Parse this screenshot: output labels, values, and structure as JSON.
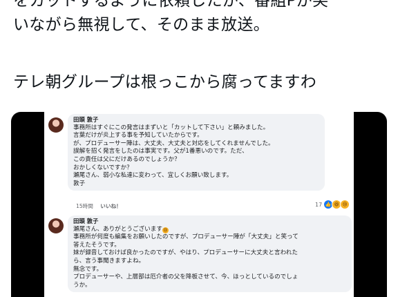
{
  "tweet": {
    "line1": "をカットするように依頼したが、番組Pが笑",
    "line2": "いながら無視して、そのまま放送。",
    "line3": "テレ朝グループは根っこから腐ってますわ"
  },
  "comments": [
    {
      "author": "田頭 敦子",
      "lines": [
        "事務所はすぐにこの発言はまずいと「カットして下さい」と頼みました。",
        "言葉だけが炎上する事を予知していたからです。",
        "が、プロデューサー陣は、大丈夫、大丈夫と対応をしてくれませんでした。",
        "誤解を招く発言をしたのは事実です。父が1番悪いのです。ただ、",
        "この責任は父にだけあるのでしょうか？",
        "おかしくないですか？",
        "瀬尾さん、弱小な私達に変わって、宜しくお願い致します。",
        "敦子"
      ],
      "time": "15時間",
      "like_label": "いいね！",
      "reaction_count": "17"
    },
    {
      "author": "田頭 敦子",
      "lines": [
        "瀬尾さん、ありがとうございます",
        "事務所が何度も編集をお願いしたのですが、プロデューサー陣が「大丈夫」と笑って",
        "答えたそうです。",
        "妹が録音しておけば良かったのですが、やはり、プロデューサーに大丈夫と言われた",
        "ら、言う事聞きますよね。",
        "無念です。",
        "プロデューサーや、上層部は厄介者の父を降板させて、今、ほっとしているのでしょ",
        "うか。"
      ]
    }
  ],
  "icons": {
    "reactions": [
      "like-icon",
      "laugh-icon",
      "sad-icon"
    ],
    "inline_emoji": "crying-face-icon"
  }
}
